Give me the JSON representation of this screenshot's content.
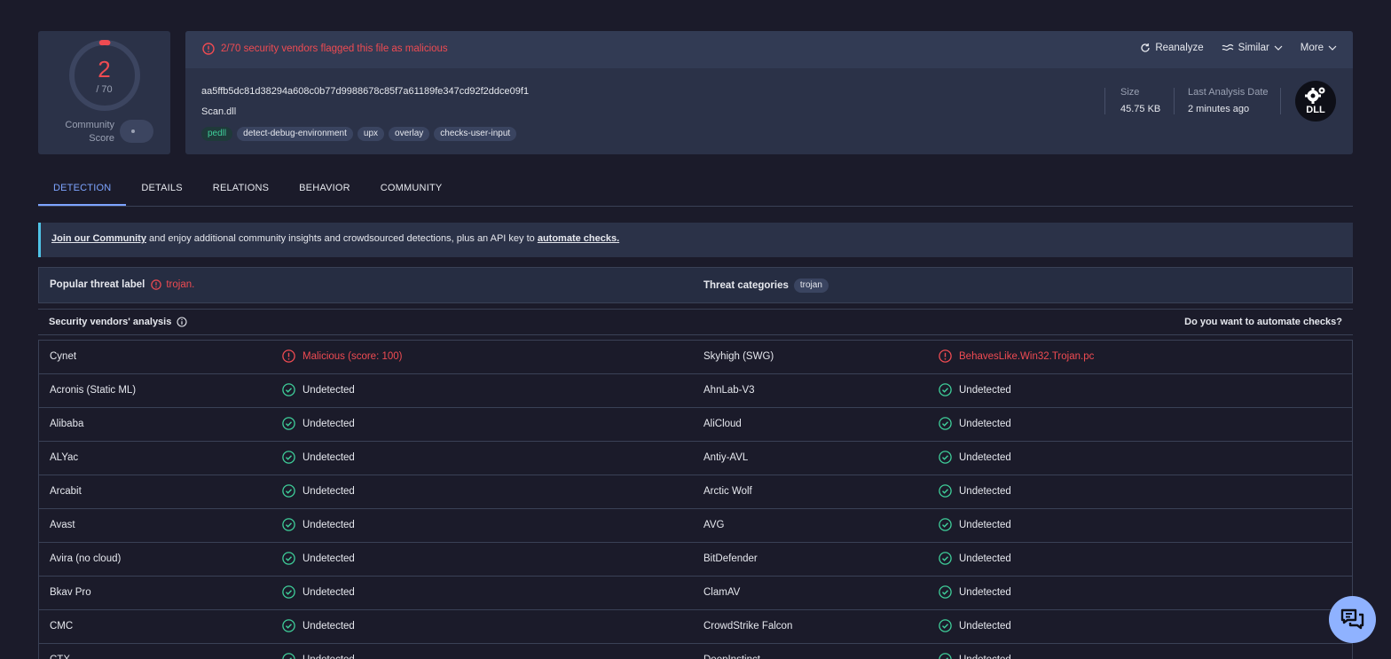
{
  "score": {
    "detections": "2",
    "total": "/ 70",
    "detection_fraction": 0.0286,
    "community_label": "Community Score",
    "community_label_line1": "Community",
    "community_label_line2": "Score"
  },
  "file": {
    "alert": "2/70 security vendors flagged this file as malicious",
    "hash": "aa5ffb5dc81d38294a608c0b77d9988678c85f7a61189fe347cd92f2ddce09f1",
    "name": "Scan.dll",
    "tags": [
      "pedll",
      "detect-debug-environment",
      "upx",
      "overlay",
      "checks-user-input"
    ],
    "size_label": "Size",
    "size_value": "45.75 KB",
    "date_label": "Last Analysis Date",
    "date_value": "2 minutes ago",
    "type_icon": "DLL"
  },
  "actions": {
    "reanalyze": "Reanalyze",
    "similar": "Similar",
    "more": "More"
  },
  "tabs": [
    "DETECTION",
    "DETAILS",
    "RELATIONS",
    "BEHAVIOR",
    "COMMUNITY"
  ],
  "banner": {
    "join": "Join our Community",
    "middle": " and enjoy additional community insights and crowdsourced detections, plus an API key to ",
    "automate": "automate checks."
  },
  "threat": {
    "label_title": "Popular threat label",
    "label_value": "trojan.",
    "categories_title": "Threat categories",
    "categories": [
      "trojan"
    ]
  },
  "vendors": {
    "title": "Security vendors' analysis",
    "cta": "Do you want to automate checks?",
    "rows": [
      {
        "left": {
          "name": "Cynet",
          "result": "Malicious (score: 100)",
          "status": "bad"
        },
        "right": {
          "name": "Skyhigh (SWG)",
          "result": "BehavesLike.Win32.Trojan.pc",
          "status": "bad"
        }
      },
      {
        "left": {
          "name": "Acronis (Static ML)",
          "result": "Undetected",
          "status": "ok"
        },
        "right": {
          "name": "AhnLab-V3",
          "result": "Undetected",
          "status": "ok"
        }
      },
      {
        "left": {
          "name": "Alibaba",
          "result": "Undetected",
          "status": "ok"
        },
        "right": {
          "name": "AliCloud",
          "result": "Undetected",
          "status": "ok"
        }
      },
      {
        "left": {
          "name": "ALYac",
          "result": "Undetected",
          "status": "ok"
        },
        "right": {
          "name": "Antiy-AVL",
          "result": "Undetected",
          "status": "ok"
        }
      },
      {
        "left": {
          "name": "Arcabit",
          "result": "Undetected",
          "status": "ok"
        },
        "right": {
          "name": "Arctic Wolf",
          "result": "Undetected",
          "status": "ok"
        }
      },
      {
        "left": {
          "name": "Avast",
          "result": "Undetected",
          "status": "ok"
        },
        "right": {
          "name": "AVG",
          "result": "Undetected",
          "status": "ok"
        }
      },
      {
        "left": {
          "name": "Avira (no cloud)",
          "result": "Undetected",
          "status": "ok"
        },
        "right": {
          "name": "BitDefender",
          "result": "Undetected",
          "status": "ok"
        }
      },
      {
        "left": {
          "name": "Bkav Pro",
          "result": "Undetected",
          "status": "ok"
        },
        "right": {
          "name": "ClamAV",
          "result": "Undetected",
          "status": "ok"
        }
      },
      {
        "left": {
          "name": "CMC",
          "result": "Undetected",
          "status": "ok"
        },
        "right": {
          "name": "CrowdStrike Falcon",
          "result": "Undetected",
          "status": "ok"
        }
      },
      {
        "left": {
          "name": "CTX",
          "result": "Undetected",
          "status": "ok"
        },
        "right": {
          "name": "DeepInstinct",
          "result": "Undetected",
          "status": "ok"
        }
      }
    ]
  },
  "colors": {
    "bg": "#1b1b2a",
    "card": "#2b3248",
    "malicious": "#ef4b52",
    "clean": "#3fcf9a",
    "accent": "#7da4ff"
  },
  "icons": {
    "alert": "alert-circle-icon",
    "check": "check-circle-icon",
    "info": "info-icon",
    "reanalyze": "refresh-icon",
    "similar": "similar-icon",
    "chevron": "chevron-down-icon",
    "chat": "chat-icon",
    "dll": "dll-gear-icon"
  }
}
